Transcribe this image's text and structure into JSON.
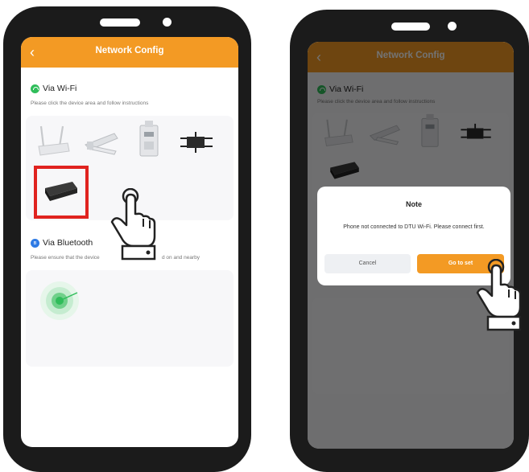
{
  "header": {
    "title": "Network Config",
    "back_glyph": "‹"
  },
  "wifi": {
    "title": "Via Wi-Fi",
    "hint": "Please click the device area and follow instructions"
  },
  "bluetooth": {
    "title": "Via Bluetooth",
    "hint_left": "Please ensure that the device",
    "hint_right": "d on and nearby",
    "icon": "bluetooth-icon"
  },
  "devices": [
    "router-device",
    "antenna-adapter-device",
    "din-rail-meter-device",
    "microinverter-device",
    "dtu-stick-device"
  ],
  "dialog": {
    "title": "Note",
    "message": "Phone not connected to DTU Wi-Fi. Please connect first.",
    "cancel_label": "Cancel",
    "confirm_label": "Go to set"
  },
  "colors": {
    "accent": "#f39a24",
    "highlight": "#e0231f",
    "wifi_green": "#2fbd5a",
    "bt_blue": "#2d7ae5"
  }
}
